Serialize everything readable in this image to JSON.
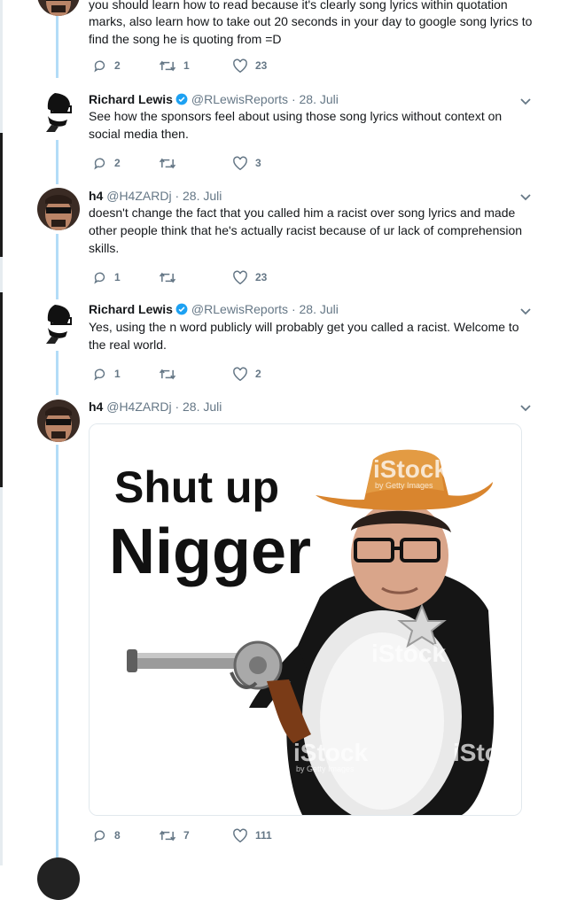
{
  "tweets": [
    {
      "text_partial_top": "you should learn how to read because it's clearly song lyrics within quotation",
      "text_rest": "marks, also learn how to take out 20 seconds in your day to google song lyrics to find the song he is quoting from =D",
      "replies": "2",
      "retweets": "1",
      "likes": "23"
    },
    {
      "name": "Richard Lewis",
      "handle": "@RLewisReports",
      "date": "· 28. Juli",
      "text": "See how the sponsors feel about using those song lyrics without context on social media then.",
      "replies": "2",
      "retweets": "",
      "likes": "3"
    },
    {
      "name": "h4",
      "handle": "@H4ZARDj",
      "date": "· 28. Juli",
      "text": "doesn't change the fact that you called him a racist over song lyrics and made other people think that he's actually racist because of ur lack of comprehension skills.",
      "replies": "1",
      "retweets": "",
      "likes": "23"
    },
    {
      "name": "Richard Lewis",
      "handle": "@RLewisReports",
      "date": "· 28. Juli",
      "text": "Yes, using the n word publicly will probably get you called a racist. Welcome to the real world.",
      "replies": "1",
      "retweets": "",
      "likes": "2"
    },
    {
      "name": "h4",
      "handle": "@H4ZARDj",
      "date": "· 28. Juli",
      "image_caption_line1": "Shut up",
      "image_caption_line2": "Nigger",
      "watermark": "iStock",
      "watermark_sub": "by Getty Images",
      "replies": "8",
      "retweets": "7",
      "likes": "111"
    }
  ],
  "colors": {
    "accent": "#1da1f2",
    "thread": "#b3dcf7",
    "muted": "#657786",
    "text": "#14171a"
  },
  "icons": [
    "reply-icon",
    "retweet-icon",
    "like-icon",
    "chevron-down-icon",
    "verified-badge-icon"
  ]
}
